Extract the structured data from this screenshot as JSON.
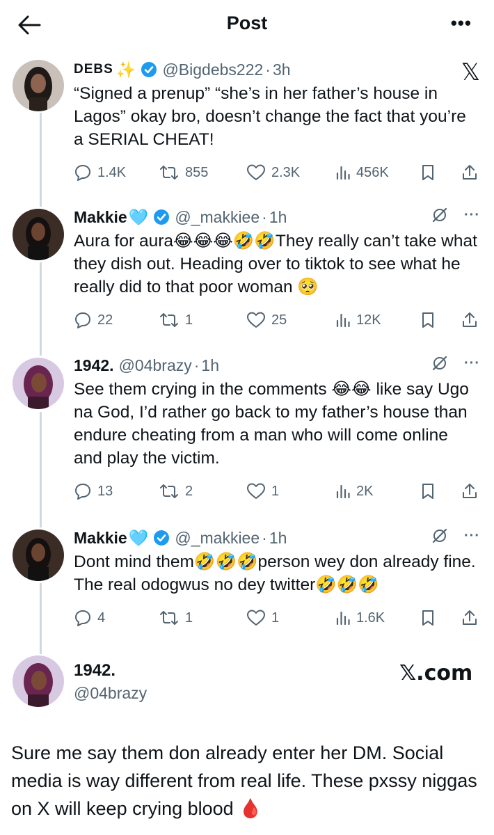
{
  "header": {
    "title": "Post"
  },
  "tweets": [
    {
      "name": "DEBS",
      "name_emoji": "✨",
      "handle": "@Bigdebs222",
      "time": "3h",
      "text": "“Signed a prenup” “she’s in her father’s house in Lagos” okay bro, doesn’t change the fact that you’re a SERIAL CHEAT!",
      "replies": "1.4K",
      "reposts": "855",
      "likes": "2.3K",
      "views": "456K",
      "right_icon": "𝕏"
    },
    {
      "name": "Makkie",
      "name_emoji": "🩵",
      "handle": "@_makkiee",
      "time": "1h",
      "text": "Aura for aura😂😂😂🤣🤣They really can’t take what they dish out. Heading over to tiktok to see what he really did to that poor woman 🥺",
      "replies": "22",
      "reposts": "1",
      "likes": "25",
      "views": "12K"
    },
    {
      "name": "1942.",
      "handle": "@04brazy",
      "time": "1h",
      "text": "See them crying in the comments 😂😂 like say Ugo na God, I’d rather go back to my father’s house than endure cheating from a man who will come online and play the victim.",
      "replies": "13",
      "reposts": "2",
      "likes": "1",
      "views": "2K"
    },
    {
      "name": "Makkie",
      "name_emoji": "🩵",
      "handle": "@_makkiee",
      "time": "1h",
      "text": "Dont mind them🤣🤣🤣person wey don already fine. The real odogwus no dey twitter🤣🤣🤣",
      "replies": "4",
      "reposts": "1",
      "likes": "1",
      "views": "1.6K"
    }
  ],
  "final_post": {
    "name": "1942.",
    "handle": "@04brazy",
    "watermark": "𝕏.com",
    "text": "Sure me say them don already enter her DM. Social media is way different from real life. These pxssy niggas on X will keep crying blood 🩸"
  },
  "colors": {
    "text": "#0f1419",
    "muted": "#536471",
    "verified": "#1d9bf0",
    "line": "#cfd9de"
  }
}
